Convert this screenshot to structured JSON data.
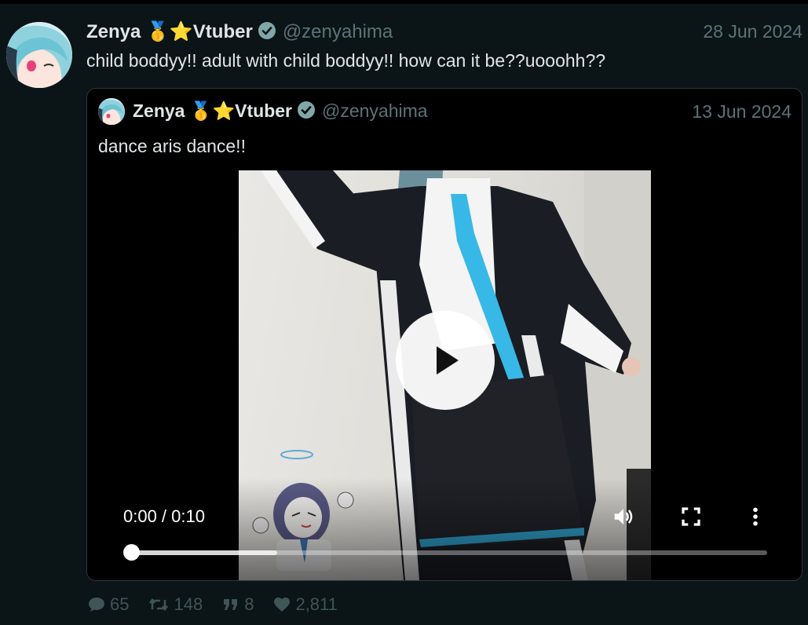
{
  "post": {
    "author_name": "Zenya 🥇⭐Vtuber",
    "handle": "@zenyahima",
    "date": "28 Jun 2024",
    "text": "child boddyy!! adult with child boddyy!! how can it be??uooohh??"
  },
  "quote": {
    "author_name": "Zenya 🥇⭐Vtuber",
    "handle": "@zenyahima",
    "date": "13 Jun 2024",
    "text": "dance aris dance!!"
  },
  "video": {
    "time": "0:00 / 0:10",
    "progress": 0,
    "buffered": 0.23,
    "icons": [
      "play-icon",
      "volume-icon",
      "fullscreen-icon",
      "more-options-icon"
    ]
  },
  "stats": {
    "replies": "65",
    "retweets": "148",
    "quotes": "8",
    "likes": "2,811"
  },
  "colors": {
    "background": "#0b1416",
    "muted": "#5b7378",
    "verified": "#7fa7a9",
    "action": "#3f5558"
  }
}
